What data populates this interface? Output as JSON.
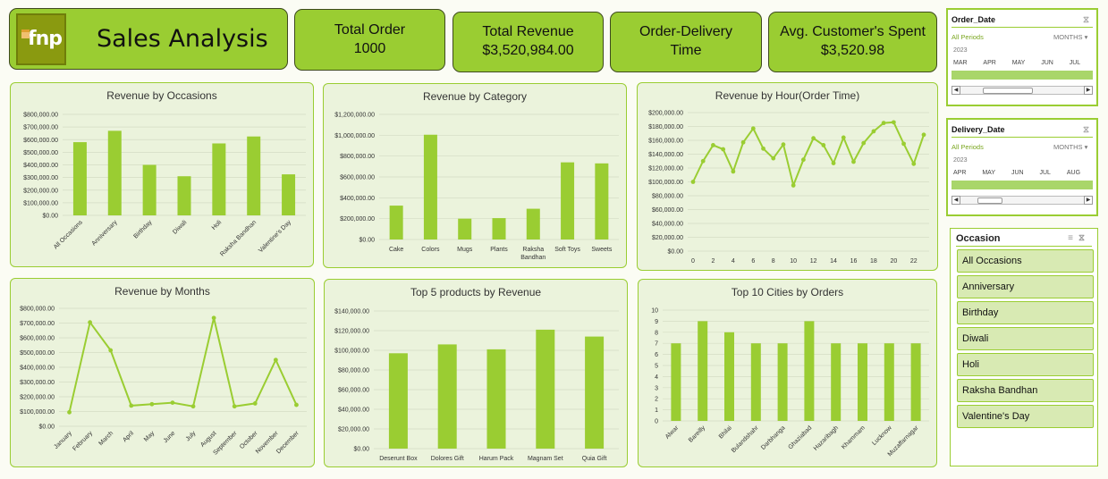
{
  "header": {
    "title": "Sales Analysis",
    "logo_text": "fnp"
  },
  "kpis": [
    {
      "label": "Total Order",
      "value": "1000"
    },
    {
      "label": "Total Revenue",
      "value": "$3,520,984.00"
    },
    {
      "label": "Order-Delivery",
      "value": "Time"
    },
    {
      "label": "Avg. Customer's Spent",
      "value": "$3,520.98"
    }
  ],
  "slicers": {
    "order_date": {
      "title": "Order_Date",
      "periods": "All Periods",
      "unit": "MONTHS",
      "year": "2023",
      "months": [
        "MAR",
        "APR",
        "MAY",
        "JUN",
        "JUL"
      ]
    },
    "delivery_date": {
      "title": "Delivery_Date",
      "periods": "All Periods",
      "unit": "MONTHS",
      "year": "2023",
      "months": [
        "APR",
        "MAY",
        "JUN",
        "JUL",
        "AUG"
      ]
    },
    "occasion": {
      "title": "Occasion",
      "items": [
        "All Occasions",
        "Anniversary",
        "Birthday",
        "Diwali",
        "Holi",
        "Raksha Bandhan",
        "Valentine's Day"
      ]
    }
  },
  "colors": {
    "accent": "#9acd32",
    "panel_bg": "#ebf3dc",
    "bar": "#9acd32",
    "line": "#9acd32"
  },
  "chart_data": [
    {
      "id": "occasions",
      "type": "bar",
      "title": "Revenue by Occasions",
      "categories": [
        "All Occasions",
        "Anniversary",
        "Birthday",
        "Diwali",
        "Holi",
        "Raksha Bandhan",
        "Valentine's Day"
      ],
      "values": [
        580000,
        670000,
        400000,
        310000,
        570000,
        625000,
        325000
      ],
      "ylim": [
        0,
        800000
      ],
      "yticks": [
        "$0.00",
        "$100,000.00",
        "$200,000.00",
        "$300,000.00",
        "$400,000.00",
        "$500,000.00",
        "$600,000.00",
        "$700,000.00",
        "$800,000.00"
      ],
      "grid": true
    },
    {
      "id": "category",
      "type": "bar",
      "title": "Revenue by Category",
      "categories": [
        "Cake",
        "Colors",
        "Mugs",
        "Plants",
        "Raksha Bandhan",
        "Soft Toys",
        "Sweets"
      ],
      "values": [
        325000,
        1005000,
        200000,
        205000,
        295000,
        740000,
        730000
      ],
      "ylim": [
        0,
        1200000
      ],
      "yticks": [
        "$0.00",
        "$200,000.00",
        "$400,000.00",
        "$600,000.00",
        "$800,000.00",
        "$1,000,000.00",
        "$1,200,000.00"
      ],
      "grid": true
    },
    {
      "id": "hour",
      "type": "line",
      "title": "Revenue by Hour(Order Time)",
      "x": [
        0,
        1,
        2,
        3,
        4,
        5,
        6,
        7,
        8,
        9,
        10,
        11,
        12,
        13,
        14,
        15,
        16,
        17,
        18,
        19,
        20,
        21,
        22,
        23
      ],
      "values": [
        100000,
        130000,
        153000,
        147000,
        115000,
        157000,
        177000,
        148000,
        134000,
        154000,
        95000,
        132000,
        163000,
        153000,
        127000,
        164000,
        129000,
        156000,
        173000,
        185000,
        186000,
        155000,
        126000,
        168000
      ],
      "xticks": [
        "0",
        "2",
        "4",
        "6",
        "8",
        "10",
        "12",
        "14",
        "16",
        "18",
        "20",
        "22"
      ],
      "ylim": [
        0,
        200000
      ],
      "yticks": [
        "$0.00",
        "$20,000.00",
        "$40,000.00",
        "$60,000.00",
        "$80,000.00",
        "$100,000.00",
        "$120,000.00",
        "$140,000.00",
        "$160,000.00",
        "$180,000.00",
        "$200,000.00"
      ],
      "grid": true
    },
    {
      "id": "months",
      "type": "line",
      "title": "Revenue by Months",
      "categories": [
        "January",
        "February",
        "March",
        "April",
        "May",
        "June",
        "July",
        "August",
        "September",
        "October",
        "November",
        "December"
      ],
      "values": [
        95000,
        705000,
        515000,
        140000,
        150000,
        160000,
        135000,
        735000,
        135000,
        155000,
        450000,
        145000
      ],
      "ylim": [
        0,
        800000
      ],
      "yticks": [
        "$0.00",
        "$100,000.00",
        "$200,000.00",
        "$300,000.00",
        "$400,000.00",
        "$500,000.00",
        "$600,000.00",
        "$700,000.00",
        "$800,000.00"
      ],
      "grid": true
    },
    {
      "id": "products",
      "type": "bar",
      "title": "Top 5 products by Revenue",
      "categories": [
        "Deserunt Box",
        "Dolores Gift",
        "Harum Pack",
        "Magnam Set",
        "Quia Gift"
      ],
      "values": [
        97000,
        106000,
        101000,
        121000,
        114000
      ],
      "ylim": [
        0,
        140000
      ],
      "yticks": [
        "$0.00",
        "$20,000.00",
        "$40,000.00",
        "$60,000.00",
        "$80,000.00",
        "$100,000.00",
        "$120,000.00",
        "$140,000.00"
      ],
      "grid": true
    },
    {
      "id": "cities",
      "type": "bar",
      "title": "Top 10 Cities by Orders",
      "categories": [
        "Alwar",
        "Bareilly",
        "Bhilai",
        "Bulandshahr",
        "Darbhanga",
        "Ghaziabad",
        "Hazaribagh",
        "Khammam",
        "Lucknow",
        "Muzaffarnagar"
      ],
      "values": [
        7,
        9,
        8,
        7,
        7,
        9,
        7,
        7,
        7,
        7
      ],
      "ylim": [
        0,
        10
      ],
      "yticks": [
        "0",
        "1",
        "2",
        "3",
        "4",
        "5",
        "6",
        "7",
        "8",
        "9",
        "10"
      ],
      "grid": true
    }
  ]
}
